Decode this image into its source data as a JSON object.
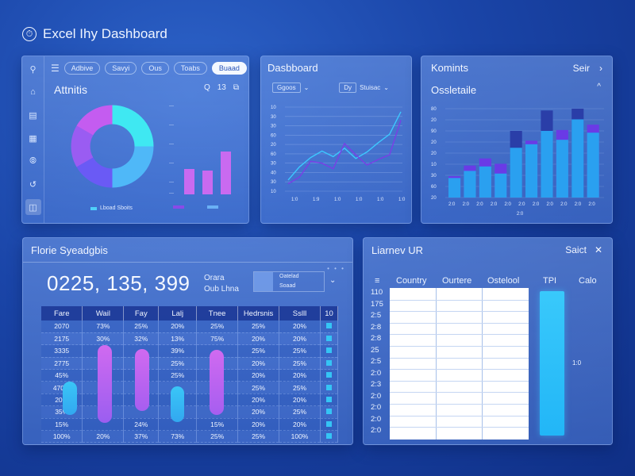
{
  "app": {
    "title": "Excel Ihy Dashboard",
    "logo_icon": "clock-icon"
  },
  "panel1": {
    "menu_icon": "hamburger-icon",
    "chips": [
      "Adbive",
      "Savyi",
      "Ous",
      "Toabs",
      "Buaad"
    ],
    "active_chip": "Buaad",
    "title": "Attnitis",
    "tool_search": "Q",
    "tool_num": "13",
    "tool_copy": "⧉",
    "sidebar_icons": [
      "search-icon",
      "home-icon",
      "table-icon",
      "document-icon",
      "compass-icon",
      "share-icon",
      "grid-icon"
    ],
    "legend": [
      "Lboad Sboits",
      "",
      ""
    ],
    "colors": {
      "donut": [
        "#c45cf0",
        "#6a5af5",
        "#3a9af5",
        "#4fd0fa",
        "#3fe8f2"
      ],
      "bars": "#c96af0"
    }
  },
  "panel2": {
    "title": "Dasbboard",
    "ctrl1": "Ggoos",
    "ctrl2_a": "Dy",
    "ctrl2_b": "Stuisac",
    "y_ticks": [
      "10",
      "30",
      "30",
      "60",
      "20",
      "60",
      "30",
      "40",
      "30",
      "10"
    ],
    "x_ticks": [
      "1:0",
      "1:9",
      "1:0",
      "1:0",
      "1:0",
      "1:0"
    ],
    "dots": "• • •",
    "chart_data": {
      "type": "line",
      "series": [
        {
          "values": [
            1.2,
            2.6,
            3.6,
            4.3,
            3.7,
            4.6,
            3.5,
            4.2,
            5.2,
            6.1,
            8.5
          ]
        },
        {
          "values": [
            0.8,
            1.5,
            3.2,
            3.0,
            2.4,
            5.1,
            3.9,
            2.8,
            3.4,
            3.9,
            7.6
          ]
        }
      ]
    }
  },
  "panel3": {
    "title": "Komints",
    "right_label": "Seir",
    "right_icon": "chevron-right-icon",
    "subtitle": "Ossletaile",
    "caret": "^",
    "y_ticks": [
      "80",
      "20",
      "90",
      "20",
      "20",
      "10",
      "30",
      "60",
      "20"
    ],
    "x_ticks": [
      "2:0",
      "2:0",
      "2:0",
      "2:0",
      "2:0",
      "2:0",
      "2:0",
      "2:0",
      "2:0",
      "2:0",
      "2:0"
    ],
    "x_center": "2:0",
    "chart_data": {
      "type": "bar",
      "series": [
        {
          "values": [
            22,
            30,
            35,
            27,
            56,
            60,
            75,
            65,
            88,
            73
          ]
        },
        {
          "values": [
            24,
            36,
            44,
            38,
            75,
            64,
            98,
            76,
            100,
            82
          ]
        }
      ]
    }
  },
  "panel4": {
    "title": "Florie Syeadgbis",
    "big_number": "0225, 135, 399",
    "side_line1": "Orara",
    "side_line2": "Oub Lhna",
    "select_line1": "Oatelad",
    "select_line2": "Soaad",
    "headers": [
      "Fare",
      "Wail",
      "Fay",
      "Lalj",
      "Tnee",
      "Hedrsnis",
      "Sslll",
      "10"
    ],
    "rows": [
      [
        "2070",
        "73%",
        "25%",
        "20%",
        "25%",
        "25%",
        "20%"
      ],
      [
        "2175",
        "30%",
        "32%",
        "13%",
        "75%",
        "20%",
        "20%"
      ],
      [
        "3335",
        "",
        "",
        "39%",
        "",
        "25%",
        "25%"
      ],
      [
        "2775",
        "",
        "",
        "25%",
        "",
        "20%",
        "25%"
      ],
      [
        "45%",
        "",
        "",
        "25%",
        "",
        "20%",
        "20%"
      ],
      [
        "470%",
        "",
        "",
        "",
        "",
        "25%",
        "25%"
      ],
      [
        "20%",
        "",
        "",
        "",
        "",
        "20%",
        "20%"
      ],
      [
        "35%",
        "",
        "",
        "",
        "",
        "20%",
        "25%"
      ],
      [
        "15%",
        "",
        "24%",
        "",
        "15%",
        "20%",
        "20%"
      ],
      [
        "100%",
        "20%",
        "37%",
        "73%",
        "25%",
        "25%",
        "100%"
      ]
    ]
  },
  "panel5": {
    "title": "Liarnev UR",
    "right_label": "Saict",
    "close_icon": "close-icon",
    "menu_icon": "list-icon",
    "headers": [
      "Country",
      "Ourtere",
      "Ostelool",
      "TPI",
      "Calo"
    ],
    "row_labels": [
      "110",
      "175",
      "2:5",
      "2:8",
      "2:8",
      "25",
      "2:5",
      "2:0",
      "2:3",
      "2:0",
      "2:0",
      "2:0",
      "2:0"
    ],
    "bar_label": "1:0"
  }
}
